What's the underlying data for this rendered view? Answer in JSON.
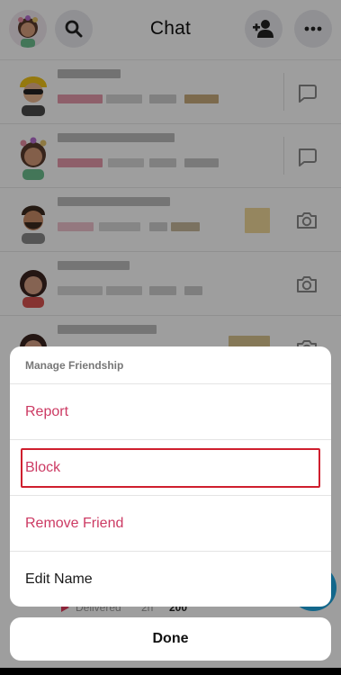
{
  "header": {
    "title": "Chat",
    "icons": [
      "user-avatar",
      "search-icon",
      "add-friend-icon",
      "more-icon"
    ]
  },
  "chat_list": {
    "rows": [
      {
        "action_icon": "chat-bubble-icon"
      },
      {
        "action_icon": "chat-bubble-icon"
      },
      {
        "action_icon": "camera-icon"
      },
      {
        "action_icon": "camera-icon"
      },
      {
        "action_icon": "camera-icon"
      }
    ],
    "peek_row": {
      "status": "Delivered",
      "time": "2h",
      "streak": "200"
    }
  },
  "sheet": {
    "header": "Manage Friendship",
    "items": [
      {
        "label": "Report"
      },
      {
        "label": "Block"
      },
      {
        "label": "Remove Friend"
      },
      {
        "label": "Edit Name"
      }
    ],
    "done_label": "Done"
  },
  "colors": {
    "danger_text": "#cc3a63",
    "highlight_border": "#cf1f2e",
    "overlay": "rgba(0,0,0,0.38)"
  }
}
